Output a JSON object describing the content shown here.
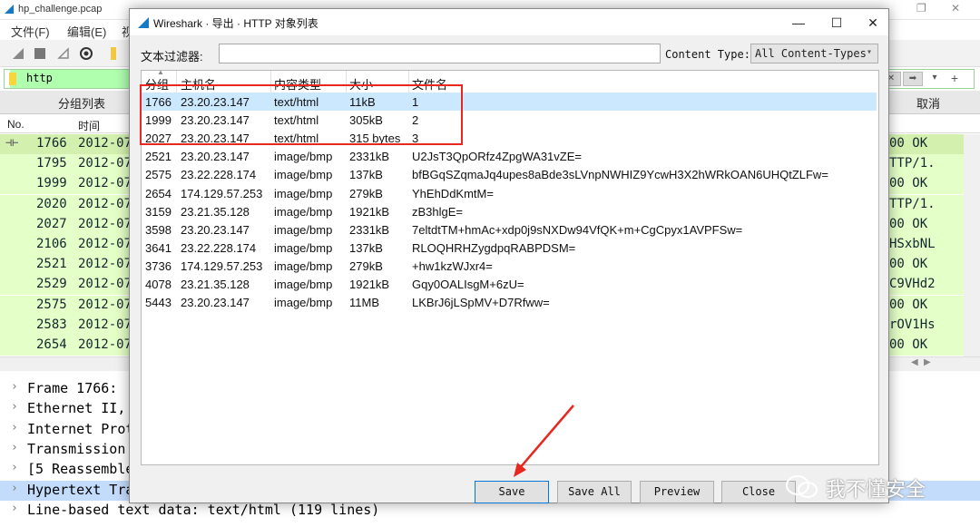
{
  "background": {
    "window_title": "hp_challenge.pcap",
    "menu": [
      "文件(F)",
      "编辑(E)",
      "视"
    ],
    "display_filter": "http",
    "bar_labels": {
      "packet_list": "分组列表",
      "cancel": "取消"
    },
    "columns": {
      "no": "No.",
      "time": "时间"
    },
    "packets": [
      {
        "no": "1766",
        "time": "2012-07",
        "right": "00 OK"
      },
      {
        "no": "1795",
        "time": "2012-07",
        "right": "TTP/1."
      },
      {
        "no": "1999",
        "time": "2012-07",
        "right": "00 OK"
      },
      {
        "no": "2020",
        "time": "2012-07",
        "right": "TTP/1."
      },
      {
        "no": "2027",
        "time": "2012-07",
        "right": "00 OK"
      },
      {
        "no": "2106",
        "time": "2012-07",
        "right": "HSxbNL"
      },
      {
        "no": "2521",
        "time": "2012-07",
        "right": "00 OK"
      },
      {
        "no": "2529",
        "time": "2012-07",
        "right": "C9VHd2"
      },
      {
        "no": "2575",
        "time": "2012-07",
        "right": "00 OK"
      },
      {
        "no": "2583",
        "time": "2012-07",
        "right": "rOV1Hs"
      },
      {
        "no": "2654",
        "time": "2012-07",
        "right": "00 OK"
      }
    ],
    "details": [
      "Frame 1766: ",
      "Ethernet II,",
      "Internet Prot",
      "Transmission",
      "[5 Reassemble",
      "Hypertext Tra",
      "Line-based text data: text/html (119 lines)"
    ]
  },
  "dialog": {
    "title": "Wireshark · 导出 · HTTP 对象列表",
    "filter_label": "文本过滤器:",
    "filter_value": "",
    "content_type_label": "Content Type:",
    "content_type_value": "All Content-Types",
    "headers": {
      "packet": "分组",
      "host": "主机名",
      "type": "内容类型",
      "size": "大小",
      "file": "文件名"
    },
    "rows": [
      {
        "packet": "1766",
        "host": "23.20.23.147",
        "type": "text/html",
        "size": "11kB",
        "file": "1"
      },
      {
        "packet": "1999",
        "host": "23.20.23.147",
        "type": "text/html",
        "size": "305kB",
        "file": "2"
      },
      {
        "packet": "2027",
        "host": "23.20.23.147",
        "type": "text/html",
        "size": "315 bytes",
        "file": "3"
      },
      {
        "packet": "2521",
        "host": "23.20.23.147",
        "type": "image/bmp",
        "size": "2331kB",
        "file": "U2JsT3QpORfz4ZpgWA31vZE="
      },
      {
        "packet": "2575",
        "host": "23.22.228.174",
        "type": "image/bmp",
        "size": "137kB",
        "file": "bfBGqSZqmaJq4upes8aBde3sLVnpNWHIZ9YcwH3X2hWRkOAN6UHQtZLFw="
      },
      {
        "packet": "2654",
        "host": "174.129.57.253",
        "type": "image/bmp",
        "size": "279kB",
        "file": "YhEhDdKmtM="
      },
      {
        "packet": "3159",
        "host": "23.21.35.128",
        "type": "image/bmp",
        "size": "1921kB",
        "file": "zB3hlgE="
      },
      {
        "packet": "3598",
        "host": "23.20.23.147",
        "type": "image/bmp",
        "size": "2331kB",
        "file": "7eltdtTM+hmAc+xdp0j9sNXDw94VfQK+m+CgCpyx1AVPFSw="
      },
      {
        "packet": "3641",
        "host": "23.22.228.174",
        "type": "image/bmp",
        "size": "137kB",
        "file": "RLOQHRHZygdpqRABPDSM="
      },
      {
        "packet": "3736",
        "host": "174.129.57.253",
        "type": "image/bmp",
        "size": "279kB",
        "file": "+hw1kzWJxr4="
      },
      {
        "packet": "4078",
        "host": "23.21.35.128",
        "type": "image/bmp",
        "size": "1921kB",
        "file": "Gqy0OALIsgM+6zU="
      },
      {
        "packet": "5443",
        "host": "23.20.23.147",
        "type": "image/bmp",
        "size": "11MB",
        "file": "LKBrJ6jLSpMV+D7Rfww="
      }
    ],
    "buttons": {
      "save": "Save",
      "save_all": "Save All",
      "preview": "Preview",
      "close": "Close"
    }
  },
  "watermark": "我不懂安全",
  "colors": {
    "highlight_box": "#e8281e",
    "selection": "#cce8ff",
    "packet_row": "#e4ffc7"
  }
}
